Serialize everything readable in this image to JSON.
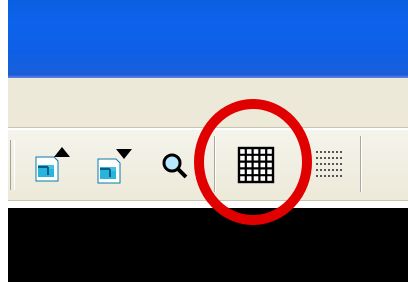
{
  "window": {
    "titlebar_color": "#0d63ec",
    "chrome_color": "#ece9d8"
  },
  "toolbar": {
    "buttons": [
      {
        "icon": "page-up-icon",
        "state": "normal"
      },
      {
        "icon": "page-down-icon",
        "state": "normal"
      },
      {
        "icon": "zoom-icon",
        "state": "normal"
      },
      {
        "icon": "grid-icon",
        "state": "highlighted"
      },
      {
        "icon": "dotted-grid-icon",
        "state": "normal"
      }
    ]
  },
  "annotation": {
    "type": "circle",
    "color": "#e00000",
    "target": "grid-icon"
  }
}
